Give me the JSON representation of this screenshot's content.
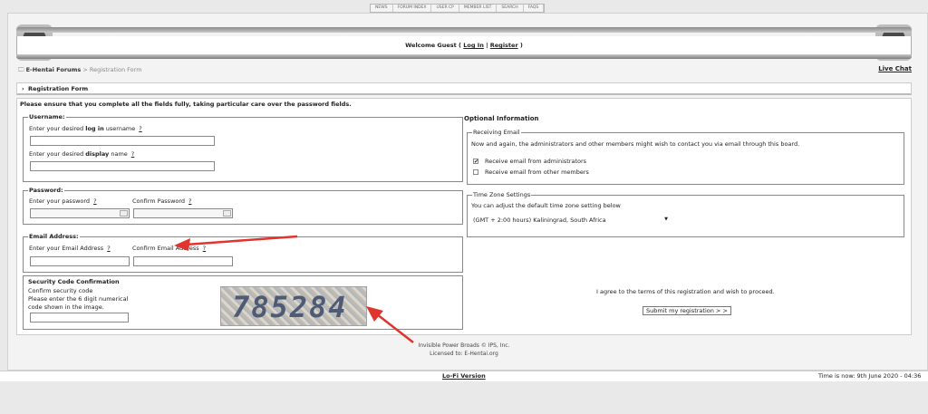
{
  "topnav": [
    "NEWS",
    "FORUM INDEX",
    "USER CP",
    "MEMBER LIST",
    "SEARCH",
    "FAQS"
  ],
  "welcome": {
    "prefix": "Welcome Guest ( ",
    "login": "Log In",
    "sep": " | ",
    "register": "Register",
    "suffix": " )"
  },
  "breadcrumb": {
    "home": "E-Hentai Forums",
    "sep": " > ",
    "current": "Registration Form"
  },
  "live_chat": "Live Chat",
  "section_title": "Registration Form",
  "intro": "Please ensure that you complete all the fields fully, taking particular care over the password fields.",
  "username": {
    "legend": "Username:",
    "login_label_pre": "Enter your desired ",
    "login_label_bold": "log in",
    "login_label_post": " username",
    "display_label_pre": "Enter your desired ",
    "display_label_bold": "display",
    "display_label_post": " name",
    "help": "?"
  },
  "password": {
    "legend": "Password:",
    "enter": "Enter your password",
    "confirm": "Confirm Password",
    "help": "?"
  },
  "email": {
    "legend": "Email Address:",
    "enter": "Enter your Email Address",
    "confirm": "Confirm Email Address",
    "help": "?"
  },
  "security": {
    "title": "Security Code Confirmation",
    "line1": "Confirm security code",
    "line2": "Please enter the 6 digit numerical",
    "line3": "code shown in the image.",
    "code": "785284"
  },
  "optional": {
    "title": "Optional Information",
    "receiving_legend": "Receiving Email",
    "receiving_desc": "Now and again, the administrators and other members might wish to contact you via email through this board.",
    "opt_admin": "Receive email from administrators",
    "opt_admin_checked": "✔",
    "opt_members": "Receive email from other members",
    "tz_legend": "Time Zone Settings",
    "tz_desc": "You can adjust the default time zone setting below",
    "tz_value": "(GMT + 2:00 hours) Kaliningrad, South Africa"
  },
  "agree_text": "I agree to the terms of this registration and wish to proceed.",
  "submit_label": "Submit my registration > >",
  "footer": {
    "line1": "Invisible Power Broads © IPS, Inc.",
    "line2": "Licensed to: E-Hentai.org"
  },
  "lofi": "Lo-Fi Version",
  "time": "Time is now: 9th June 2020 - 04:36",
  "colors": {
    "arrow": "#e0342e",
    "captcha_text": "#3d4a66"
  }
}
